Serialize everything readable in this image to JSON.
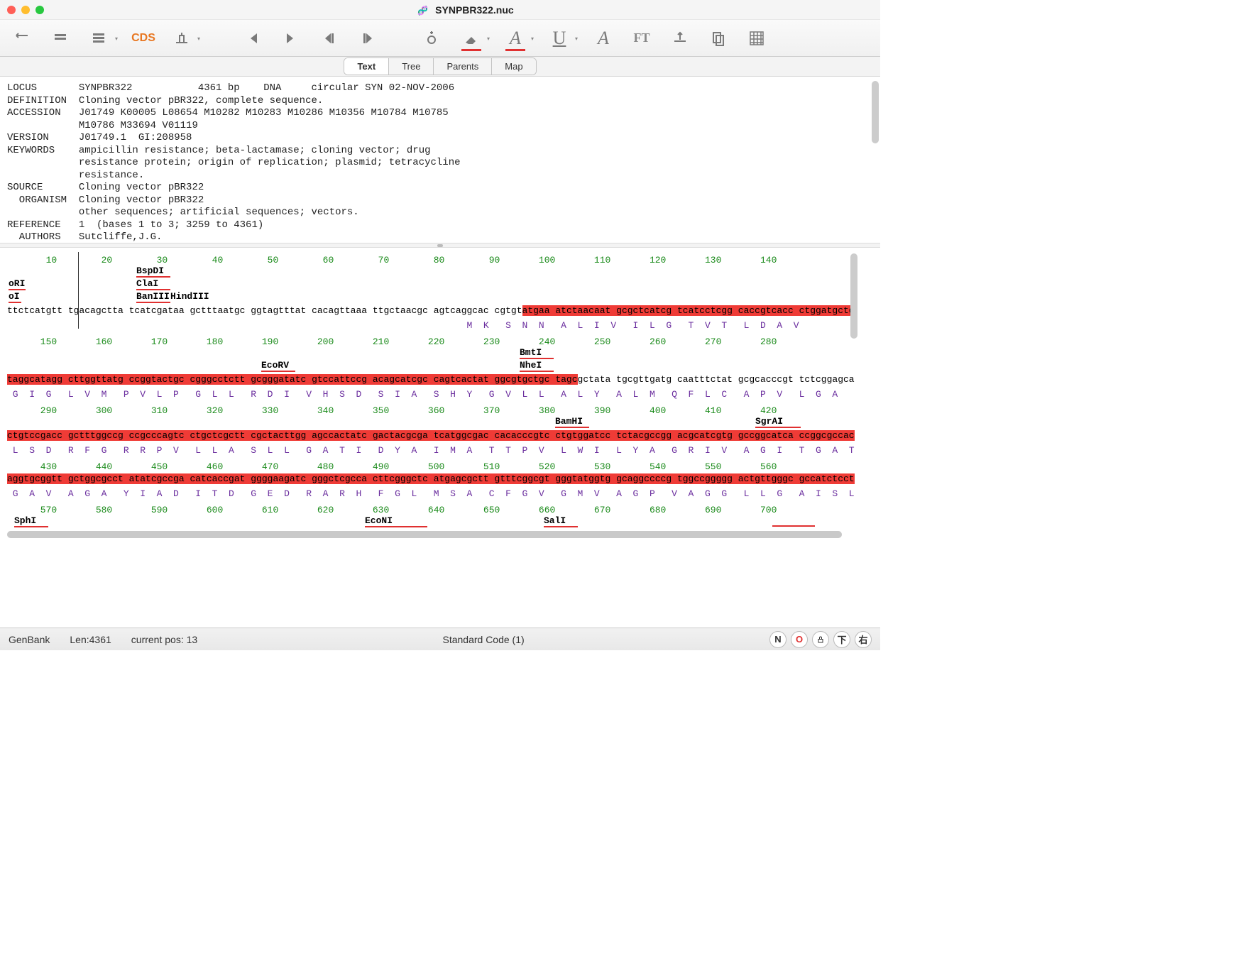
{
  "window": {
    "title": "SYNPBR322.nuc"
  },
  "tabs": {
    "text": "Text",
    "tree": "Tree",
    "parents": "Parents",
    "map": "Map",
    "active": "text"
  },
  "header_text": "LOCUS       SYNPBR322           4361 bp    DNA     circular SYN 02-NOV-2006\nDEFINITION  Cloning vector pBR322, complete sequence.\nACCESSION   J01749 K00005 L08654 M10282 M10283 M10286 M10356 M10784 M10785\n            M10786 M33694 V01119\nVERSION     J01749.1  GI:208958\nKEYWORDS    ampicillin resistance; beta-lactamase; cloning vector; drug\n            resistance protein; origin of replication; plasmid; tetracycline\n            resistance.\nSOURCE      Cloning vector pBR322\n  ORGANISM  Cloning vector pBR322\n            other sequences; artificial sequences; vectors.\nREFERENCE   1  (bases 1 to 3; 3259 to 4361)\n  AUTHORS   Sutcliffe,J.G.",
  "ruler": {
    "row1": "       10        20        30        40        50        60        70        80        90       100       110       120       130       140",
    "row2": "      150       160       170       180       190       200       210       220       230       240       250       260       270       280",
    "row3": "      290       300       310       320       330       340       350       360       370       380       390       400       410       420",
    "row4": "      430       440       450       460       470       480       490       500       510       520       530       540       550       560",
    "row5": "      570       580       590       600       610       620       630       640       650       660       670       680       690       700"
  },
  "sites": {
    "oRI": "oRI",
    "oI": "oI",
    "BspDI": "BspDI",
    "ClaI": "ClaI",
    "BanIII": "BanIII",
    "HindIII": "HindIII",
    "EcoRV": "EcoRV",
    "BmtI": "BmtI",
    "NheI": "NheI",
    "BamHI": "BamHI",
    "SgrAI": "SgrAI",
    "SphI": "SphI",
    "EcoNI": "EcoNI",
    "SalI": "SalI"
  },
  "seq": {
    "row1_pre": "ttctcatgtt tgacagctta tcatcgataa gctttaatgc ggtagtttat cacagttaaa ttgctaacgc agtcaggcac cgtgt",
    "row1_hl": "atgaa atctaacaat gcgctcatcg tcatcctcgg caccgtcacc ctggatgctg",
    "row2_hl": "taggcatagg cttggttatg ccggtactgc cgggcctctt gcgggatatc gtccattccg acagcatcgc cagtcactat ggcgtgctgc tagc",
    "row2_post": "gctata tgcgttgatg caatttctat gcgcacccgt tctcggagca",
    "row3_pre": "",
    "row3_hl": "ctgtccgacc gctttggccg ccgcccagtc ctgctcgctt cgctacttgg agccactatc gactacgcga tcatggcgac cacacccgtc ctgtg",
    "row3_mid": "gatcc tctacgccgg acgcatcgtg gccggcatca ",
    "row3_hl2": "ccggcgccac",
    "row4_hl": "aggtgcggtt gctggcgcct atatcgccga catcaccgat ggggaagatc gggctcgcca cttcgggctc atgagcgctt gtttcggcgt gggtatggtg gcaggccccg tggccggggg actgttgggc gccatctcct",
    "aa1": "                                                                                   M  K   S  N  N   A  L  I  V   I  L  G   T  V  T   L  D  A  V",
    "aa2": " G  I  G   L  V  M   P  V  L  P   G  L  L   R  D  I   V  H  S  D   S  I  A   S  H  Y   G  V  L  L   A  L  Y   A  L  M   Q  F  L  C   A  P  V   L  G  A",
    "aa3": " L  S  D   R  F  G   R  R  P  V   L  L  A   S  L  L   G  A  T  I   D  Y  A   I  M  A   T  T  P  V   L  W  I   L  Y  A   G  R  I  V   A  G  I   T  G  A  T",
    "aa4": " G  A  V   A  G  A   Y  I  A  D   I  T  D   G  E  D   R  A  R  H   F  G  L   M  S  A   C  F  G  V   G  M  V   A  G  P   V  A  G  G   L  L  G   A  I  S  L"
  },
  "status": {
    "format": "GenBank",
    "len": "Len:4361",
    "pos": "current pos:  13",
    "code": "Standard Code (1)",
    "btnN": "N",
    "btnO": "O",
    "btnDown": "下",
    "btnRight": "右"
  }
}
